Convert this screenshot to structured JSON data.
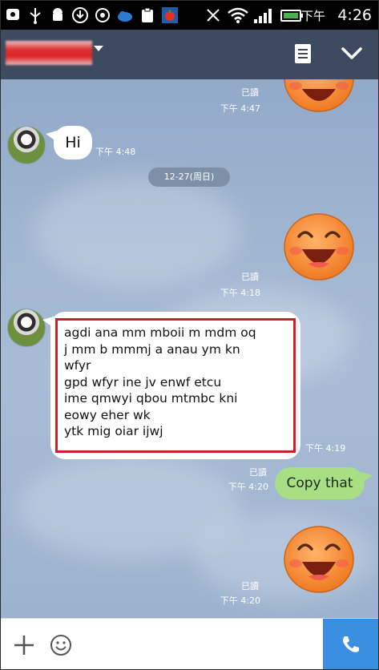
{
  "status_bar": {
    "time_prefix": "下午",
    "time": "4:26",
    "icons": [
      "notification-icon",
      "usb-icon",
      "android-icon",
      "download-icon",
      "sync-icon",
      "clipboard-icon",
      "app-icon",
      "mute-icon",
      "wifi-icon",
      "signal-icon",
      "battery-icon"
    ]
  },
  "header": {
    "title_redacted": true,
    "menu_icon": "note-icon",
    "close_icon": "chevron-down-icon"
  },
  "chat": {
    "date_separator": "12-27(周日)",
    "messages": [
      {
        "from": "me",
        "type": "sticker",
        "read": "已讀",
        "time": "下午 4:47"
      },
      {
        "from": "friend",
        "type": "text",
        "text": "Hi",
        "time": "下午 4:48"
      },
      {
        "from": "me",
        "type": "sticker",
        "read": "已讀",
        "time": "下午 4:18"
      },
      {
        "from": "friend",
        "type": "text",
        "time": "下午 4:19",
        "lines": [
          "agdi ana mm mboii m mdm oq",
          "j mm b mmmj a anau ym kn",
          "wfyr",
          "gpd wfyr ine jv enwf etcu",
          "ime qmwyi qbou mtmbc kni",
          "eowy eher wk",
          "ytk mig oiar ijwj"
        ]
      },
      {
        "from": "me",
        "type": "text",
        "text": "Copy that",
        "read": "已讀",
        "time": "下午 4:20"
      },
      {
        "from": "me",
        "type": "sticker",
        "read": "已讀",
        "time": "下午 4:20"
      }
    ]
  },
  "bottom_bar": {
    "plus_icon": "plus-icon",
    "emoji_icon": "emoji-icon",
    "call_icon": "phone-icon",
    "accent": "#3b8fe0"
  }
}
